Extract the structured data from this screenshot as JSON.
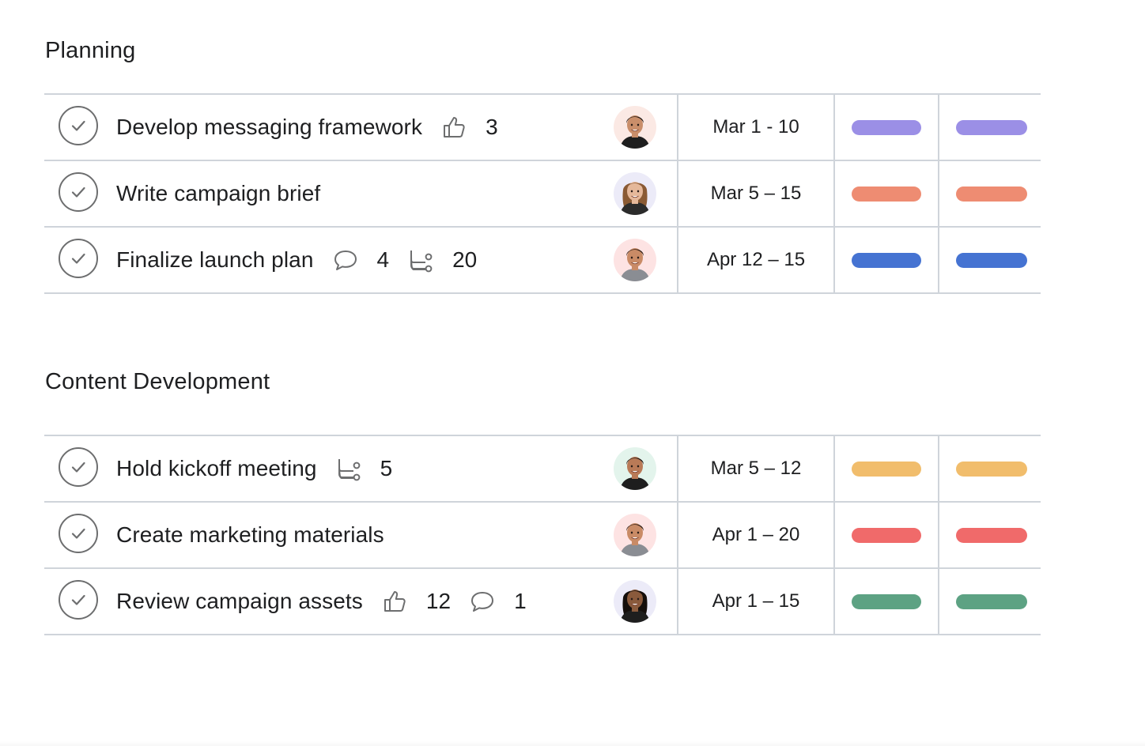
{
  "sections": [
    {
      "title": "Planning",
      "tasks": [
        {
          "name": "Develop messaging framework",
          "likes": "3",
          "date": "Mar 1 - 10",
          "avatar": {
            "skin": "#c98e6a",
            "hair": "#1b1412",
            "bg": "#fbe9e4",
            "shirt": "#1e1e1e"
          },
          "color": "#9b8fe6"
        },
        {
          "name": "Write campaign brief",
          "date": "Mar 5 – 15",
          "avatar": {
            "skin": "#e5b89a",
            "hair": "#8a5a34",
            "bg": "#ecebf8",
            "shirt": "#2b2b2b"
          },
          "color": "#ee8c72"
        },
        {
          "name": "Finalize launch plan",
          "comments": "4",
          "subtasks": "20",
          "date": "Apr 12 – 15",
          "avatar": {
            "skin": "#c98b66",
            "hair": "#2a1a12",
            "bg": "#fde3e3",
            "shirt": "#8a8d93"
          },
          "color": "#4573d2"
        }
      ]
    },
    {
      "title": "Content Development",
      "tasks": [
        {
          "name": "Hold kickoff meeting",
          "subtasks": "5",
          "date": "Mar 5 – 12",
          "avatar": {
            "skin": "#b97a57",
            "hair": "#1b1412",
            "bg": "#e3f4ec",
            "shirt": "#1e1e1e"
          },
          "color": "#f1bd6c"
        },
        {
          "name": "Create marketing materials",
          "date": "Apr 1 – 20",
          "avatar": {
            "skin": "#c98b66",
            "hair": "#2a1a12",
            "bg": "#fde3e3",
            "shirt": "#8a8d93"
          },
          "color": "#f06a6a"
        },
        {
          "name": "Review campaign assets",
          "likes": "12",
          "comments": "1",
          "date": "Apr 1 – 15",
          "avatar": {
            "skin": "#8a5a3c",
            "hair": "#140e0b",
            "bg": "#ecebf8",
            "shirt": "#1e1e1e"
          },
          "color": "#5da283"
        }
      ]
    }
  ]
}
